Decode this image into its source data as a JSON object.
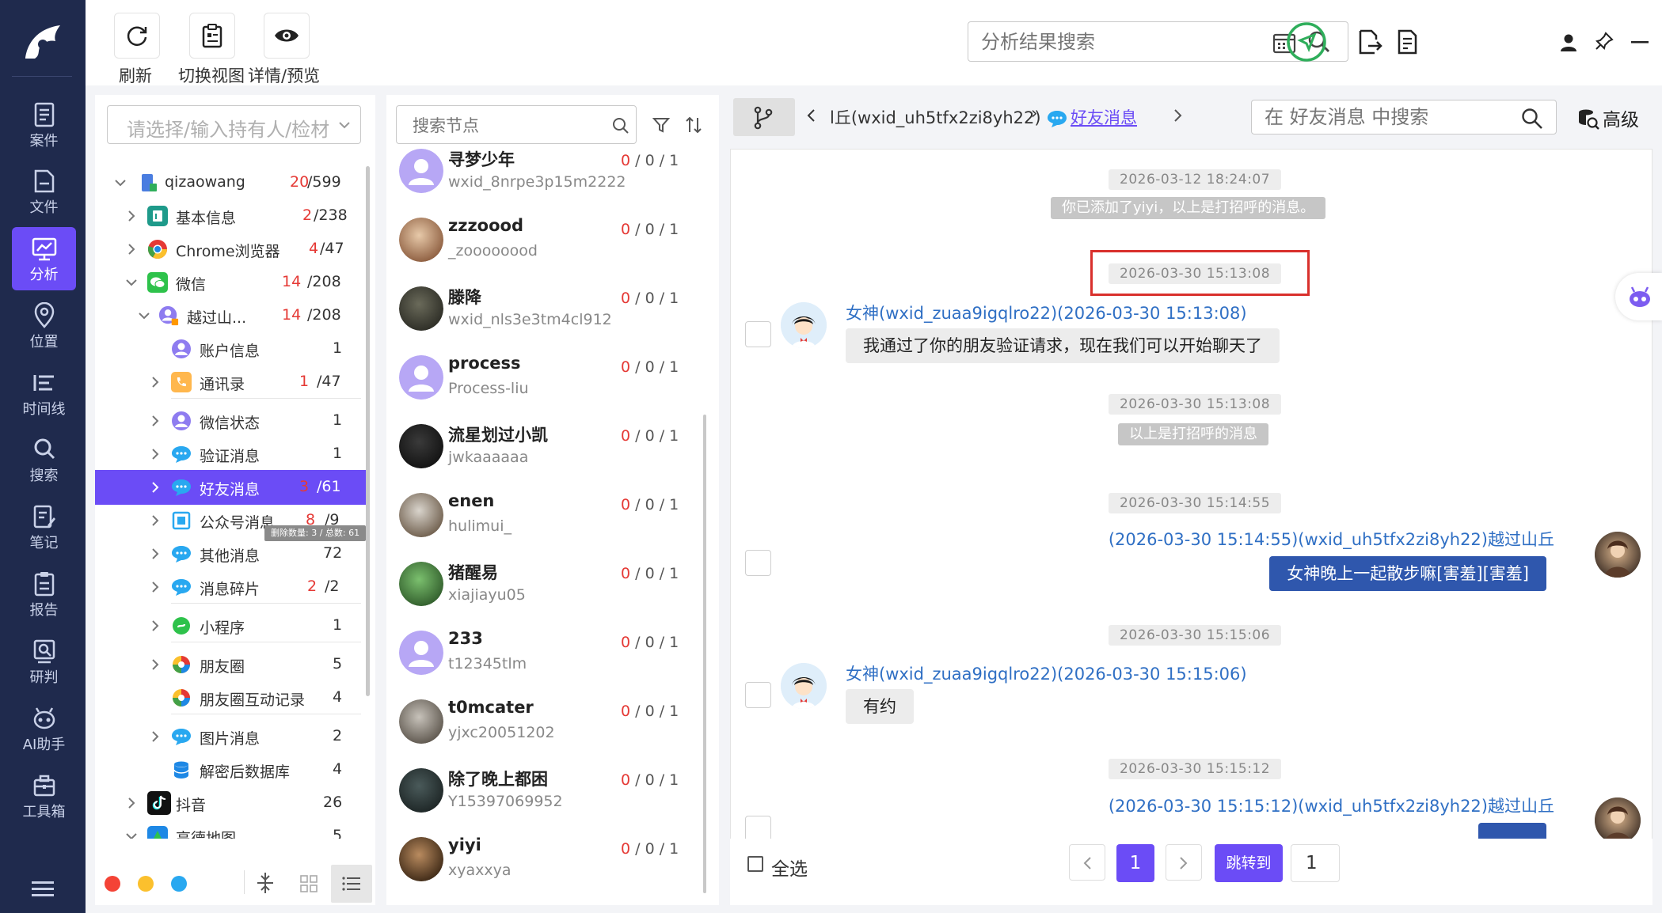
{
  "nav": {
    "items": [
      {
        "label": "案件",
        "icon": "case-icon"
      },
      {
        "label": "文件",
        "icon": "file-icon"
      },
      {
        "label": "分析",
        "icon": "analysis-icon"
      },
      {
        "label": "位置",
        "icon": "location-icon"
      },
      {
        "label": "时间线",
        "icon": "timeline-icon"
      },
      {
        "label": "搜索",
        "icon": "search-icon"
      },
      {
        "label": "笔记",
        "icon": "note-icon"
      },
      {
        "label": "报告",
        "icon": "report-icon"
      },
      {
        "label": "研判",
        "icon": "judge-icon"
      },
      {
        "label": "AI助手",
        "icon": "ai-assistant-icon"
      },
      {
        "label": "工具箱",
        "icon": "toolbox-icon"
      }
    ],
    "active_label": "分析"
  },
  "toolbar": {
    "refresh_label": "刷新",
    "switch_view_label": "切换视图",
    "detail_preview_label": "详情/预览",
    "search_placeholder": "分析结果搜索"
  },
  "owner_select": {
    "placeholder": "请选择/输入持有人/检材"
  },
  "tree": {
    "root": {
      "label": "qizaowang",
      "count_red": "20",
      "count_total": "/599"
    },
    "basic_info": {
      "label": "基本信息",
      "count_red": "2",
      "count_total": "/238"
    },
    "chrome": {
      "label": "Chrome浏览器",
      "count_red": "4",
      "count_total": "/47"
    },
    "wechat": {
      "label": "微信",
      "count_red": "14",
      "count_total": "/208"
    },
    "account": {
      "label": "越过山...",
      "count_red": "14",
      "count_total": "/208"
    },
    "account_info": {
      "label": "账户信息",
      "count": "1"
    },
    "contacts": {
      "label": "通讯录",
      "count_red": "1",
      "count_total": "/47"
    },
    "status": {
      "label": "微信状态",
      "count": "1"
    },
    "verify": {
      "label": "验证消息",
      "count": "1"
    },
    "friend_msg": {
      "label": "好友消息",
      "count_red": "3",
      "count_total": "/61"
    },
    "official": {
      "label": "公众号消息",
      "count_red": "8",
      "count_total": "/9"
    },
    "tooltip": "删除数量: 3 / 总数: 61",
    "other": {
      "label": "其他消息",
      "count": "72"
    },
    "fragments": {
      "label": "消息碎片",
      "count_red": "2",
      "count_total": "/2"
    },
    "miniprogram": {
      "label": "小程序",
      "count": "1"
    },
    "moments": {
      "label": "朋友圈",
      "count": "5"
    },
    "moments_interact": {
      "label": "朋友圈互动记录",
      "count": "4"
    },
    "image_msg": {
      "label": "图片消息",
      "count": "2"
    },
    "decrypted_db": {
      "label": "解密后数据库",
      "count": "4"
    },
    "douyin": {
      "label": "抖音",
      "count": "26"
    },
    "amap": {
      "label": "高德地图",
      "count": "5"
    }
  },
  "node_search": {
    "placeholder": "搜索节点"
  },
  "contact_list": [
    {
      "name": "寻梦少年",
      "sub": "wxid_8nrpe3p15m2222",
      "red": "0",
      "rest": " / 0 / 1"
    },
    {
      "name": "zzzoood",
      "sub": "_zoooooood",
      "red": "0",
      "rest": " / 0 / 1"
    },
    {
      "name": "滕降",
      "sub": "wxid_nls3e3tm4cl912",
      "red": "0",
      "rest": " / 0 / 1"
    },
    {
      "name": "process",
      "sub": "Process-liu",
      "red": "0",
      "rest": " / 0 / 1"
    },
    {
      "name": "流星划过小凯",
      "sub": "jwkaaaaaa",
      "red": "0",
      "rest": " / 0 / 1"
    },
    {
      "name": "enen",
      "sub": "hulimui_",
      "red": "0",
      "rest": " / 0 / 1"
    },
    {
      "name": "猪醒易",
      "sub": "xiajiayu05",
      "red": "0",
      "rest": " / 0 / 1"
    },
    {
      "name": "233",
      "sub": "t12345tlm",
      "red": "0",
      "rest": " / 0 / 1"
    },
    {
      "name": "t0mcater",
      "sub": "yjxc20051202",
      "red": "0",
      "rest": " / 0 / 1"
    },
    {
      "name": "除了晚上都困",
      "sub": "Y15397069952",
      "red": "0",
      "rest": " / 0 / 1"
    },
    {
      "name": "yiyi",
      "sub": "xyaxxya",
      "red": "0",
      "rest": " / 0 / 1"
    }
  ],
  "breadcrumb": {
    "path": "l丘(wxid_uh5tfx2zi8yh22)",
    "sep": "›",
    "current": "好友消息"
  },
  "chat_search": {
    "placeholder": "在 好友消息 中搜索"
  },
  "advanced_label": "高级",
  "messages": {
    "ts1": "2026-03-12 18:24:07",
    "sys1": "你已添加了yiyi，以上是打招呼的消息。",
    "ts2": "2026-03-30 15:13:08",
    "sender1": "女神(wxid_zuaa9igqlro22)(2026-03-30 15:13:08)",
    "bubble1": "我通过了你的朋友验证请求，现在我们可以开始聊天了",
    "ts3": "2026-03-30 15:13:08",
    "sys2": "以上是打招呼的消息",
    "ts4": "2026-03-30 15:14:55",
    "sender2": "(2026-03-30 15:14:55)(wxid_uh5tfx2zi8yh22)越过山丘",
    "bubble2": "女神晚上一起散步嘛[害羞][害羞]",
    "ts5": "2026-03-30 15:15:06",
    "sender3": "女神(wxid_zuaa9igqlro22)(2026-03-30 15:15:06)",
    "bubble3": "有约",
    "ts6": "2026-03-30 15:15:12",
    "sender4": "(2026-03-30 15:15:12)(wxid_uh5tfx2zi8yh22)越过山丘"
  },
  "footer": {
    "select_all": "全选",
    "page": "1",
    "jump_label": "跳转到",
    "jump_value": "1"
  },
  "colors": {
    "nav_bg": "#1f2a4d",
    "accent": "#6b4cf6",
    "highlight_box": "#d9302c",
    "bubble_out": "#2f57ad"
  }
}
